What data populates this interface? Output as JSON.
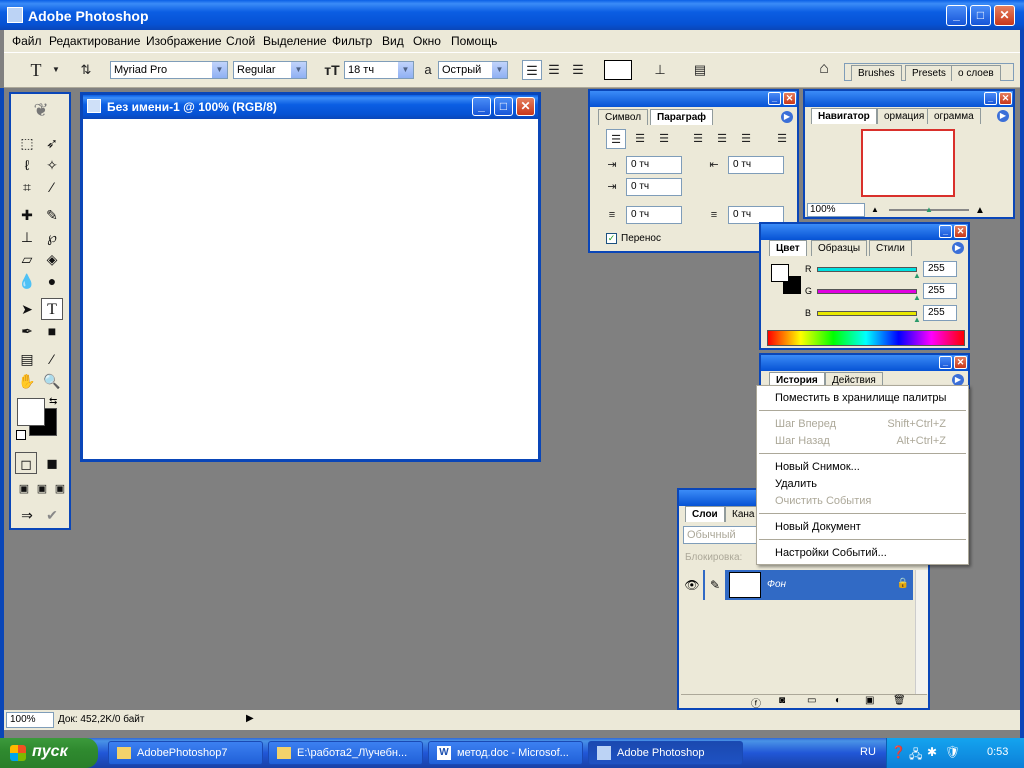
{
  "app": {
    "title": "Adobe Photoshop"
  },
  "menu": [
    "Файл",
    "Редактирование",
    "Изображение",
    "Слой",
    "Выделение",
    "Фильтр",
    "Вид",
    "Окно",
    "Помощь"
  ],
  "options": {
    "font_family": "Myriad Pro",
    "font_style": "Regular",
    "font_size": "18 тч",
    "antialias": "Острый",
    "palette_tabs": [
      "Brushes",
      "Presets",
      "о слоев"
    ]
  },
  "document": {
    "title": "Без имени-1 @ 100% (RGB/8)"
  },
  "paragraph": {
    "tabs": [
      "Символ",
      "Параграф"
    ],
    "fields": [
      "0 тч",
      "0 тч",
      "0 тч",
      "0 тч",
      "0 тч"
    ],
    "hyphenate": "Перенос"
  },
  "navigator": {
    "tabs": [
      "Навигатор",
      "ормация",
      "ограмма"
    ],
    "zoom": "100%"
  },
  "color": {
    "tabs": [
      "Цвет",
      "Образцы",
      "Стили"
    ],
    "channels": [
      {
        "label": "R",
        "value": "255",
        "color": "#00e0e0"
      },
      {
        "label": "G",
        "value": "255",
        "color": "#e000e0"
      },
      {
        "label": "B",
        "value": "255",
        "color": "#e8e800"
      }
    ]
  },
  "history": {
    "tabs": [
      "История",
      "Действия"
    ]
  },
  "context_menu": [
    {
      "label": "Поместить в хранилище палитры",
      "shortcut": "",
      "disabled": false
    },
    {
      "label": "Шаг Вперед",
      "shortcut": "Shift+Ctrl+Z",
      "disabled": true
    },
    {
      "label": "Шаг Назад",
      "shortcut": "Alt+Ctrl+Z",
      "disabled": true
    },
    {
      "label": "Новый Снимок...",
      "shortcut": "",
      "disabled": false
    },
    {
      "label": "Удалить",
      "shortcut": "",
      "disabled": false
    },
    {
      "label": "Очистить События",
      "shortcut": "",
      "disabled": true
    },
    {
      "label": "Новый Документ",
      "shortcut": "",
      "disabled": false
    },
    {
      "label": "Настройки Событий...",
      "shortcut": "",
      "disabled": false
    }
  ],
  "layers": {
    "tabs": [
      "Слои",
      "Кана"
    ],
    "blend": "Обычный",
    "lock_label": "Блокировка:",
    "layer_name": "Фон"
  },
  "status": {
    "zoom": "100%",
    "doc": "Док: 452,2K/0 байт"
  },
  "taskbar": {
    "start": "пуск",
    "tasks": [
      "AdobePhotoshop7",
      "E:\\работа2_Л\\учебн...",
      "метод.doc - Microsof...",
      "Adobe Photoshop"
    ],
    "lang": "RU",
    "clock": "0:53"
  }
}
